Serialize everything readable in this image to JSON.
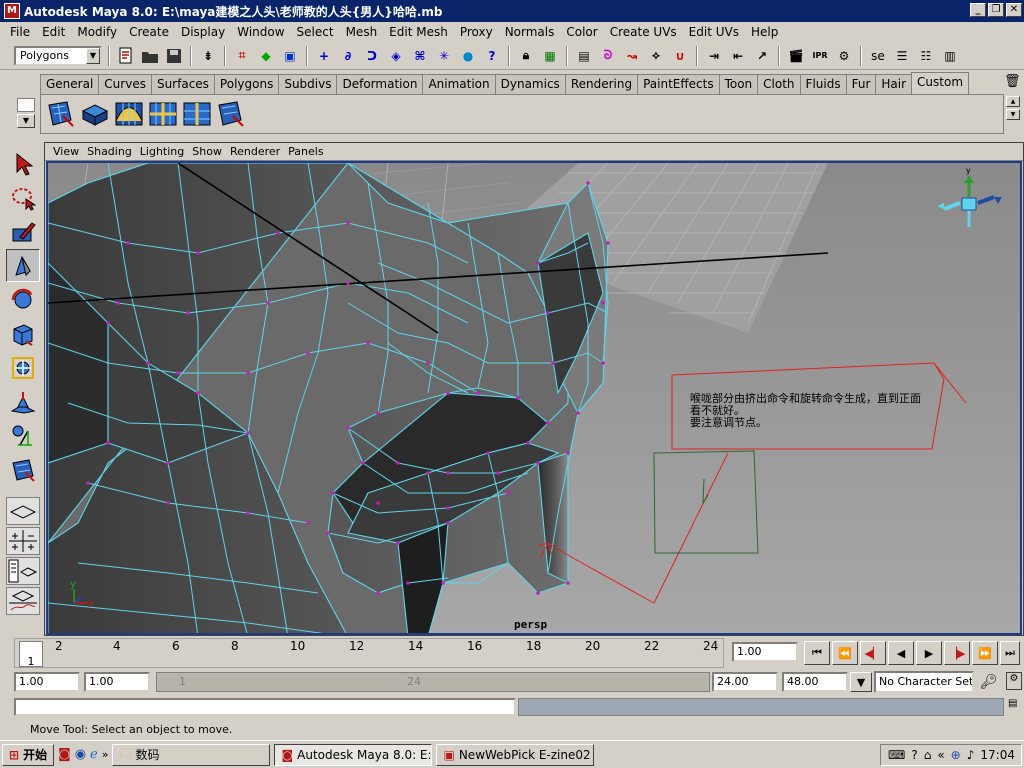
{
  "window": {
    "title": "Autodesk Maya 8.0: E:\\maya建模之人头\\老师教的人头{男人}哈哈.mb"
  },
  "menu": [
    "File",
    "Edit",
    "Modify",
    "Create",
    "Display",
    "Window",
    "Select",
    "Mesh",
    "Edit Mesh",
    "Proxy",
    "Normals",
    "Color",
    "Create UVs",
    "Edit UVs",
    "Help"
  ],
  "statusline": {
    "mode": "Polygons",
    "truncated_label": "se"
  },
  "shelf_tabs": [
    "General",
    "Curves",
    "Surfaces",
    "Polygons",
    "Subdivs",
    "Deformation",
    "Animation",
    "Dynamics",
    "Rendering",
    "PaintEffects",
    "Toon",
    "Cloth",
    "Fluids",
    "Fur",
    "Hair",
    "Custom"
  ],
  "active_shelf_tab": "Custom",
  "panel_menu": [
    "View",
    "Shading",
    "Lighting",
    "Show",
    "Renderer",
    "Panels"
  ],
  "viewport": {
    "camera": "persp",
    "annotation_lines": [
      "喉咙部分由挤出命令和旋转命令生成，直到正面",
      "看不就好。",
      "要注意调节点。"
    ],
    "gizmo_axis_y": "y",
    "axis_x": "x",
    "axis_y": "y"
  },
  "timeline": {
    "ticks": [
      "2",
      "4",
      "6",
      "8",
      "10",
      "12",
      "14",
      "16",
      "18",
      "20",
      "22",
      "24"
    ],
    "current_frame": "1",
    "current_time_field": "1.00"
  },
  "range": {
    "start_time": "1.00",
    "playback_start": "1.00",
    "range_start_label": "1",
    "range_end_label": "24",
    "playback_end": "24.00",
    "end_time": "48.00",
    "character_set": "No Character Set"
  },
  "help_line": "Move Tool: Select an object to move.",
  "taskbar": {
    "start": "开始",
    "items": [
      "数码",
      "Autodesk Maya 8.0: E:\\...",
      "NewWebPick E-zine02"
    ],
    "clock": "17:04"
  },
  "colors": {
    "title_bar": "#0a246a",
    "wire": "#5fd4ea",
    "vertex": "#c020c0",
    "annotation_red": "#e02020",
    "annotation_green": "#2e6a2e",
    "viewport_border": "#1e3a8a"
  }
}
